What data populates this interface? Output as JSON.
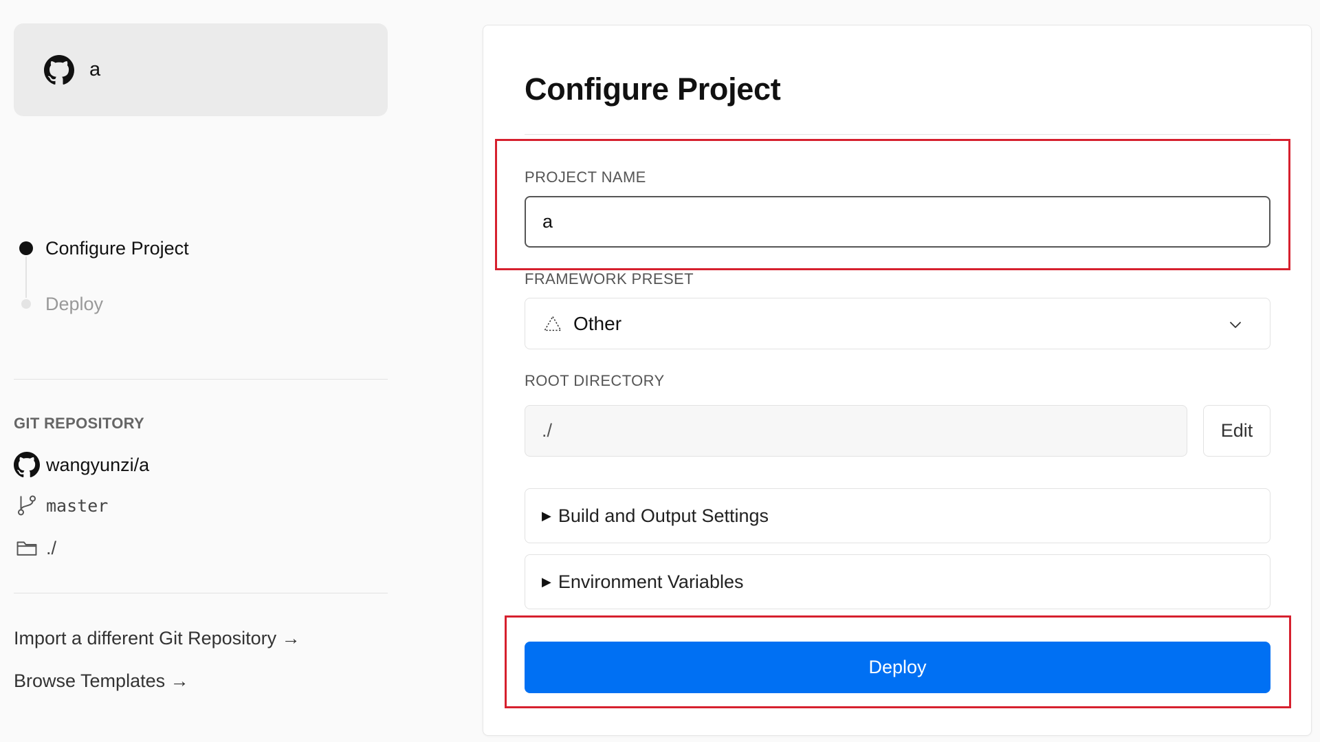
{
  "repo_card": {
    "name": "a",
    "icon": "github-icon"
  },
  "steps": [
    {
      "label": "Configure Project",
      "active": true
    },
    {
      "label": "Deploy",
      "active": false
    }
  ],
  "git": {
    "title": "GIT REPOSITORY",
    "repo": "wangyunzi/a",
    "branch": "master",
    "directory": "./"
  },
  "links": {
    "import": "Import a different Git Repository →",
    "templates": "Browse Templates →"
  },
  "configure": {
    "title": "Configure Project",
    "project_name_label": "PROJECT NAME",
    "project_name_value": "a",
    "framework_label": "FRAMEWORK PRESET",
    "framework_value": "Other",
    "root_label": "ROOT DIRECTORY",
    "root_value": "./",
    "edit_label": "Edit",
    "build_settings_label": "Build and Output Settings",
    "env_vars_label": "Environment Variables",
    "deploy_label": "Deploy"
  },
  "colors": {
    "accent": "#0070f3",
    "highlight": "#d6202e"
  }
}
